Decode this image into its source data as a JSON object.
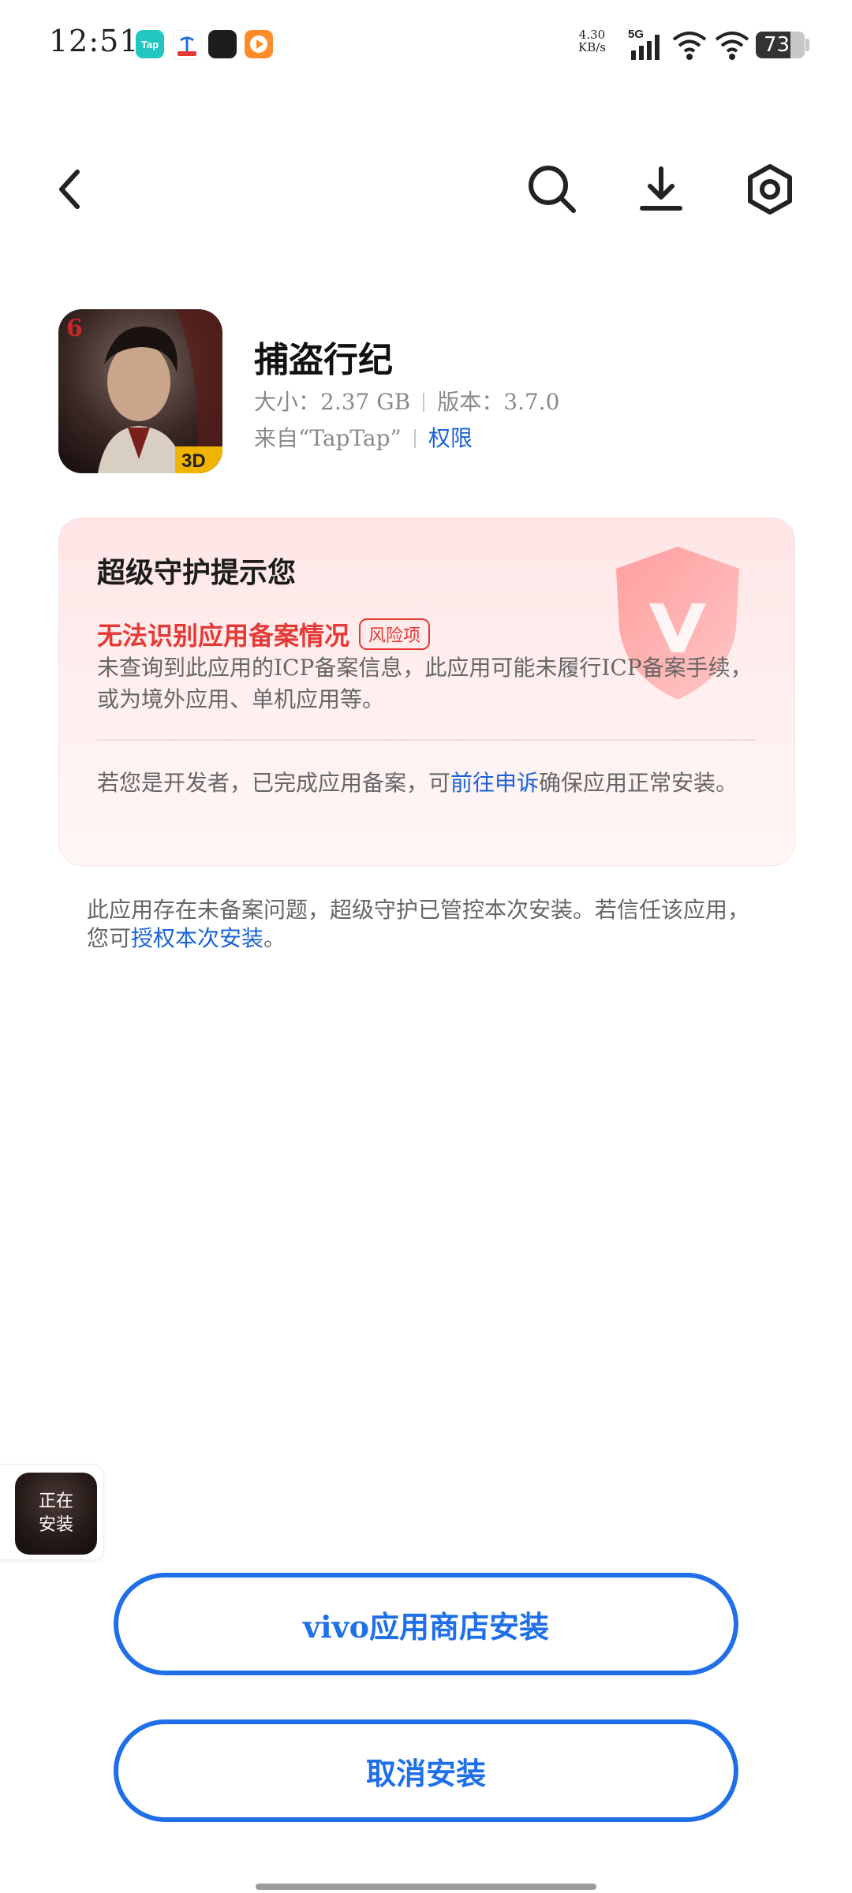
{
  "status_bar": {
    "time": "12:51",
    "net_speed_value": "4.30",
    "net_speed_unit": "KB/s",
    "network": "5G",
    "battery": "73",
    "tap_icon_text": "Tap",
    "colors": {
      "tap": "#22c7c1",
      "telecom": "#ffffff",
      "app3": "#1d1d1d",
      "video": "#ff8c2a"
    }
  },
  "toolbar": {
    "back_icon": "chevron-left-icon",
    "search_icon": "search-icon",
    "download_icon": "download-icon",
    "settings_icon": "settings-icon"
  },
  "app": {
    "name": "捕盗行纪",
    "size_label": "大小：2.37 GB",
    "version_label": "版本：3.7.0",
    "source_label": "来自“TapTap”",
    "permissions_link": "权限",
    "icon_badge_top": "6",
    "icon_badge_bottom": "3D"
  },
  "guard_card": {
    "title": "超级守护提示您",
    "risk_title": "无法识别应用备案情况",
    "risk_badge": "风险项",
    "risk_desc": "未查询到此应用的ICP备案信息，此应用可能未履行ICP备案手续，或为境外应用、单机应用等。",
    "dev_prefix": "若您是开发者，已完成应用备案，可",
    "dev_link": "前往申诉",
    "dev_suffix": "确保应用正常安装。",
    "accent_color": "#e53935"
  },
  "notice": {
    "prefix": "此应用存在未备案问题，超级守护已管控本次安装。若信任该应用，您可",
    "link": "授权本次安装",
    "suffix": "。"
  },
  "floating": {
    "label_line1": "正在",
    "label_line2": "安装"
  },
  "buttons": {
    "store_install": "vivo应用商店安装",
    "cancel_install": "取消安装",
    "color": "#1f6fe8"
  }
}
